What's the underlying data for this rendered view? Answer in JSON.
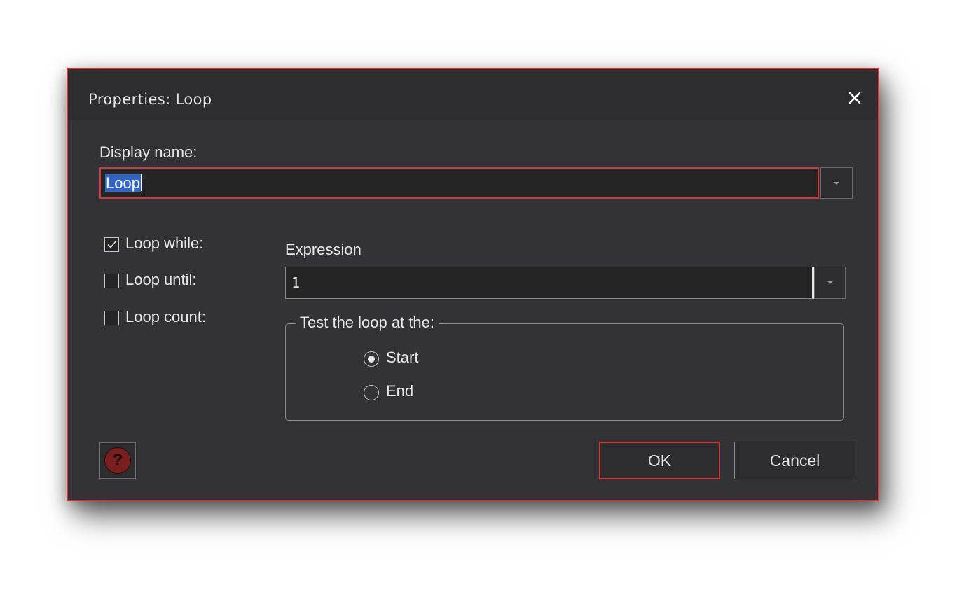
{
  "dialog": {
    "title": "Properties: Loop",
    "accent_color": "#d23a3a"
  },
  "display_name": {
    "label": "Display name:",
    "value": "Loop"
  },
  "loop_options": [
    {
      "label": "Loop while:",
      "checked": true
    },
    {
      "label": "Loop until:",
      "checked": false
    },
    {
      "label": "Loop count:",
      "checked": false
    }
  ],
  "expression": {
    "label": "Expression",
    "value": "1"
  },
  "test_group": {
    "legend": "Test the loop at the:",
    "options": [
      {
        "label": "Start",
        "selected": true
      },
      {
        "label": "End",
        "selected": false
      }
    ]
  },
  "buttons": {
    "ok": "OK",
    "cancel": "Cancel",
    "help_icon": "?"
  }
}
